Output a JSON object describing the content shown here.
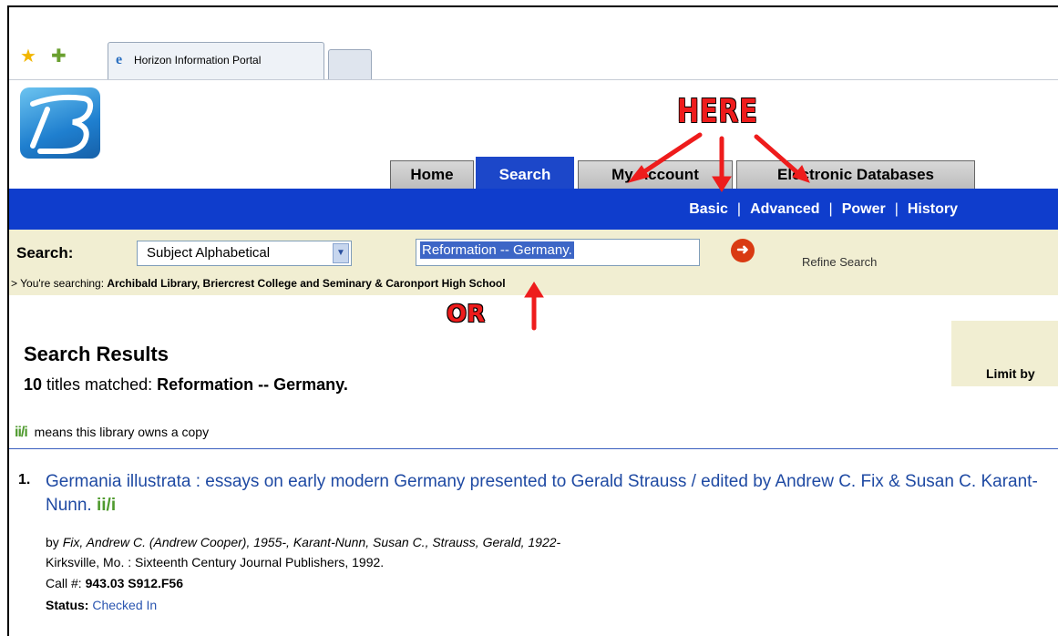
{
  "browser": {
    "tab_title": "Horizon Information Portal"
  },
  "portal": {
    "tabs": [
      {
        "label": "Home"
      },
      {
        "label": "Search"
      },
      {
        "label": "My Account"
      },
      {
        "label": "Electronic Databases"
      }
    ],
    "subnav": [
      "Basic",
      "Advanced",
      "Power",
      "History"
    ]
  },
  "search": {
    "label": "Search:",
    "type_selected": "Subject Alphabetical",
    "query": "Reformation -- Germany.",
    "refine_label": "Refine Search",
    "searching_prefix": "> You're searching:",
    "searching_scope": "Archibald Library, Briercrest College and Seminary & Caronport High School"
  },
  "results": {
    "heading": "Search Results",
    "count": "10",
    "matched_text": "titles matched:",
    "matched_term": "Reformation -- Germany.",
    "owns_icon_text": "ii/i",
    "owns_text": "means this library owns a copy",
    "limit_label": "Limit by",
    "items": [
      {
        "number": "1.",
        "title": "Germania illustrata : essays on early modern Germany presented to Gerald Strauss / edited by Andrew C. Fix & Susan C. Karant-Nunn.",
        "authors_prefix": "by",
        "authors": "Fix, Andrew C. (Andrew Cooper), 1955-, Karant-Nunn, Susan C., Strauss, Gerald, 1922-",
        "publisher": "Kirksville, Mo. : Sixteenth Century Journal Publishers, 1992.",
        "call_label": "Call #:",
        "call_number": "943.03 S912.F56",
        "status_label": "Status:",
        "status_value": "Checked In"
      }
    ]
  },
  "annotations": {
    "here": "HERE",
    "or": "OR"
  },
  "colors": {
    "nav_blue": "#0f3dcc",
    "search_band": "#f1eed2",
    "link_blue": "#1f4aa3",
    "annotation_red": "#ee1c1c",
    "owns_green": "#4f9a2e"
  }
}
